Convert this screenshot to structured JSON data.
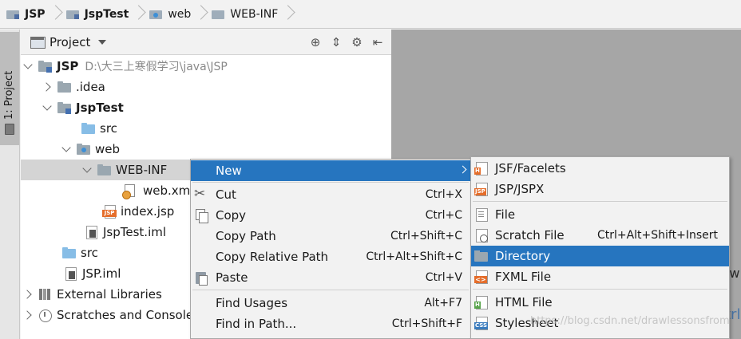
{
  "breadcrumb": [
    {
      "label": "JSP",
      "icon": "module-icon",
      "bold": true
    },
    {
      "label": "JspTest",
      "icon": "module-icon",
      "bold": true
    },
    {
      "label": "web",
      "icon": "web-folder-icon",
      "bold": false
    },
    {
      "label": "WEB-INF",
      "icon": "folder-icon",
      "bold": false
    }
  ],
  "tool_strip": {
    "tab_label": "1: Project"
  },
  "project_panel": {
    "title": "Project",
    "tree": [
      {
        "label": "JSP",
        "path": "D:\\大三上寒假学习\\java\\JSP"
      },
      {
        "label": ".idea"
      },
      {
        "label": "JspTest"
      },
      {
        "label": "src"
      },
      {
        "label": "web"
      },
      {
        "label": "WEB-INF"
      },
      {
        "label": "web.xml"
      },
      {
        "label": "index.jsp"
      },
      {
        "label": "JspTest.iml"
      },
      {
        "label": "src"
      },
      {
        "label": "JSP.iml"
      },
      {
        "label": "External Libraries"
      },
      {
        "label": "Scratches and Consoles"
      }
    ]
  },
  "context_menu": {
    "items": [
      {
        "label": "New",
        "shortcut": ""
      },
      {
        "label": "Cut",
        "shortcut": "Ctrl+X"
      },
      {
        "label": "Copy",
        "shortcut": "Ctrl+C"
      },
      {
        "label": "Copy Path",
        "shortcut": "Ctrl+Shift+C"
      },
      {
        "label": "Copy Relative Path",
        "shortcut": "Ctrl+Alt+Shift+C"
      },
      {
        "label": "Paste",
        "shortcut": "Ctrl+V"
      },
      {
        "label": "Find Usages",
        "shortcut": "Alt+F7"
      },
      {
        "label": "Find in Path...",
        "shortcut": "Ctrl+Shift+F"
      }
    ]
  },
  "new_submenu": {
    "items": [
      {
        "label": "JSF/Facelets",
        "badge": "H",
        "shortcut": ""
      },
      {
        "label": "JSP/JSPX",
        "badge": "JSP",
        "shortcut": ""
      },
      {
        "label": "File",
        "shortcut": ""
      },
      {
        "label": "Scratch File",
        "shortcut": "Ctrl+Alt+Shift+Insert"
      },
      {
        "label": "Directory",
        "shortcut": ""
      },
      {
        "label": "FXML File",
        "badge": "<>",
        "shortcut": ""
      },
      {
        "label": "HTML File",
        "badge": "H",
        "shortcut": ""
      },
      {
        "label": "Stylesheet",
        "badge": "CSS",
        "shortcut": ""
      }
    ]
  },
  "editor_peek": {
    "line1": "/w",
    "line2": "trl"
  },
  "watermark": "https://blog.csdn.net/drawlessonsfrom",
  "colors": {
    "selection": "#2675bf",
    "editor_bg": "#a6a6a6",
    "tree_selected": "#d4d4d4"
  }
}
